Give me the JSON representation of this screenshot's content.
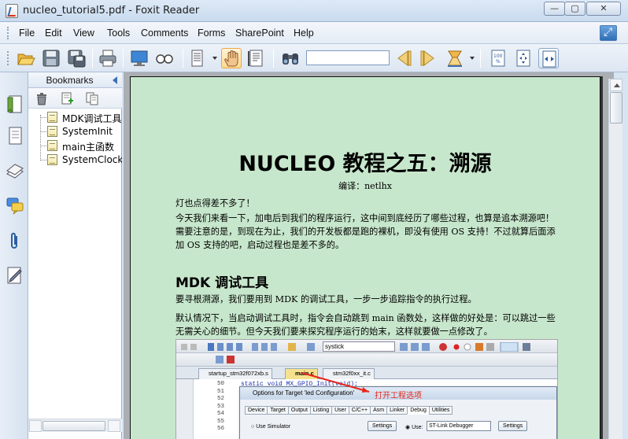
{
  "window": {
    "title": "nucleo_tutorial5.pdf - Foxit Reader",
    "controls": {
      "minimize": "—",
      "maximize": "▢",
      "close": "✕"
    }
  },
  "menu": {
    "items": [
      "File",
      "Edit",
      "View",
      "Tools",
      "Comments",
      "Forms",
      "SharePoint",
      "Help"
    ]
  },
  "toolbar": {
    "buttons": [
      "open-icon",
      "save-icon",
      "save-as-icon",
      "print-icon",
      "fullscreen-icon",
      "read-mode-icon",
      "page-layout-icon",
      "hand-tool-icon",
      "select-text-icon",
      "find-icon",
      "previous-icon",
      "next-icon",
      "highlight-icon",
      "actual-size-icon",
      "fit-page-icon",
      "fit-width-icon"
    ],
    "find_value": "",
    "active_tool": "hand-tool-icon",
    "accent": "#ffd98e"
  },
  "nav": {
    "buttons": [
      "bookmarks-icon",
      "pages-icon",
      "layers-icon",
      "comments-icon",
      "attachments-icon",
      "signatures-icon"
    ]
  },
  "bookmarks": {
    "title": "Bookmarks",
    "tools": [
      "delete-bookmark-icon",
      "add-bookmark-icon",
      "add-child-bookmark-icon"
    ],
    "items": [
      "MDK调试工具",
      "SystemInit",
      "main主函数",
      "SystemClock_"
    ]
  },
  "document": {
    "background": "#c7e7cc",
    "title": "NUCLEO 教程之五：溯源",
    "translator": "编译：netlhx",
    "para1": "灯也点得差不多了！",
    "para2": "今天我们来看一下，加电后到我们的程序运行，这中间到底经历了哪些过程，也算是追本溯源吧！需要注意的是，到现在为止，我们的开发板都是跑的裸机，即没有使用 OS 支持！不过就算后面添加 OS 支持的吧，启动过程也是差不多的。",
    "heading": "MDK 调试工具",
    "para3": "要寻根溯源，我们要用到 MDK 的调试工具，一步一步追踪指令的执行过程。",
    "para4": "默认情况下，当启动调试工具时，指令会自动跳到 main 函数处，这样做的好处是：可以跳过一些无需关心的细节。但今天我们要来探究程序运行的始末，这样就要做一点修改了。"
  },
  "screenshot": {
    "search_value": "systick",
    "left_combo": "ation",
    "tabs": [
      "startup_stm32f072xb.s",
      "main.c",
      "stm32f0xx_it.c"
    ],
    "line_numbers": [
      "50",
      "51",
      "52",
      "53",
      "54",
      "55",
      "56"
    ],
    "code_line": "static void MX_GPIO_Init(void);",
    "dialog_title": "Options for Target 'led Configuration'",
    "dialog_tabs": [
      "Device",
      "Target",
      "Output",
      "Listing",
      "User",
      "C/C++",
      "Asm",
      "Linker",
      "Debug",
      "Utilities"
    ],
    "active_dialog_tab": "Debug",
    "use_simulator": "Use Simulator",
    "settings": "Settings",
    "use_label": "Use:",
    "debugger": "ST-Link Debugger",
    "annotation": "打开工程选项",
    "annotation_color": "#e8261b"
  }
}
